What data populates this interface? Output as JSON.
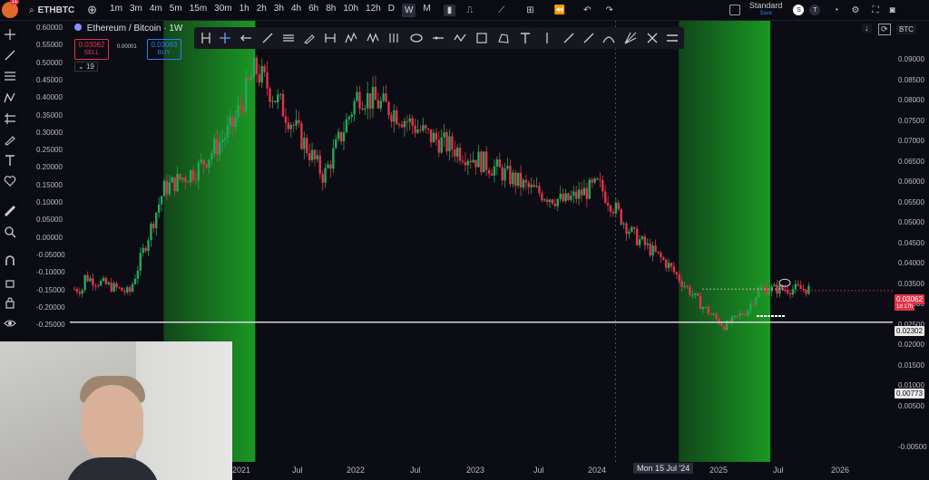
{
  "topbar": {
    "notification_count": "11",
    "symbol": "ETHBTC",
    "intervals": [
      "1m",
      "3m",
      "4m",
      "5m",
      "15m",
      "30m",
      "1h",
      "2h",
      "3h",
      "4h",
      "6h",
      "8h",
      "10h",
      "12h",
      "D",
      "W",
      "M"
    ],
    "active_interval": "W",
    "layout_name": "Standard",
    "layout_status": "Save",
    "avatar_letters": [
      "S",
      "T"
    ]
  },
  "legend": {
    "title": "Ethereum / Bitcoin · 1W",
    "sell_price": "0.03062",
    "sell_label": "SELL",
    "spread": "0.00001",
    "buy_price": "0.03063",
    "buy_label": "BUY",
    "indicator_count": "19"
  },
  "right_axis": {
    "currency": "BTC",
    "ticks": [
      "0.09000",
      "0.08500",
      "0.08000",
      "0.07500",
      "0.07000",
      "0.06500",
      "0.06000",
      "0.05500",
      "0.05000",
      "0.04500",
      "0.04000",
      "0.03500",
      "0.03000",
      "0.02500",
      "0.02000",
      "0.01500",
      "0.01000",
      "0.00500",
      "-0.00500"
    ],
    "current_price": "0.03062",
    "countdown": "1d 17h",
    "line_price": "0.02302",
    "lower_price": "0.00773"
  },
  "left_axis": {
    "ticks": [
      "0.60000",
      "0.55000",
      "0.50000",
      "0.45000",
      "0.40000",
      "0.35000",
      "0.30000",
      "0.25000",
      "0.20000",
      "0.15000",
      "0.10000",
      "0.05000",
      "0.00000",
      "-0.05000",
      "-0.10000",
      "-0.15000",
      "-0.20000",
      "-0.25000"
    ]
  },
  "x_axis": {
    "ticks": [
      "2021",
      "Jul",
      "2022",
      "Jul",
      "2023",
      "Jul",
      "2024",
      "Jul",
      "2025",
      "Jul",
      "2026"
    ],
    "crosshair_label": "Mon 15 Jul '24"
  },
  "colors": {
    "bg": "#0c0d14",
    "up": "#26a65b",
    "down": "#e0344b",
    "zone": "#1db026",
    "line": "#d8d8dc",
    "price_badge": "#e0344b"
  },
  "chart_data": {
    "type": "candlestick",
    "title": "Ethereum / Bitcoin · 1W",
    "x": [
      "2020-09",
      "2021-01",
      "2021-04",
      "2021-07",
      "2021-10",
      "2021-12",
      "2022-03",
      "2022-06",
      "2022-09",
      "2022-12",
      "2023-03",
      "2023-06",
      "2023-09",
      "2023-12",
      "2024-03",
      "2024-06",
      "2024-09",
      "2024-12",
      "2025-03",
      "2025-05",
      "2025-07",
      "2025-08"
    ],
    "close": [
      0.034,
      0.03,
      0.055,
      0.06,
      0.07,
      0.084,
      0.072,
      0.058,
      0.078,
      0.074,
      0.068,
      0.064,
      0.06,
      0.055,
      0.052,
      0.056,
      0.044,
      0.037,
      0.027,
      0.022,
      0.026,
      0.031
    ],
    "ylim": [
      -0.006,
      0.092
    ],
    "highlight_zones": [
      [
        "2021-04",
        "2021-12"
      ],
      [
        "2025-01",
        "2025-09"
      ]
    ],
    "horizontal_line": 0.02302,
    "current_price": 0.03062
  }
}
